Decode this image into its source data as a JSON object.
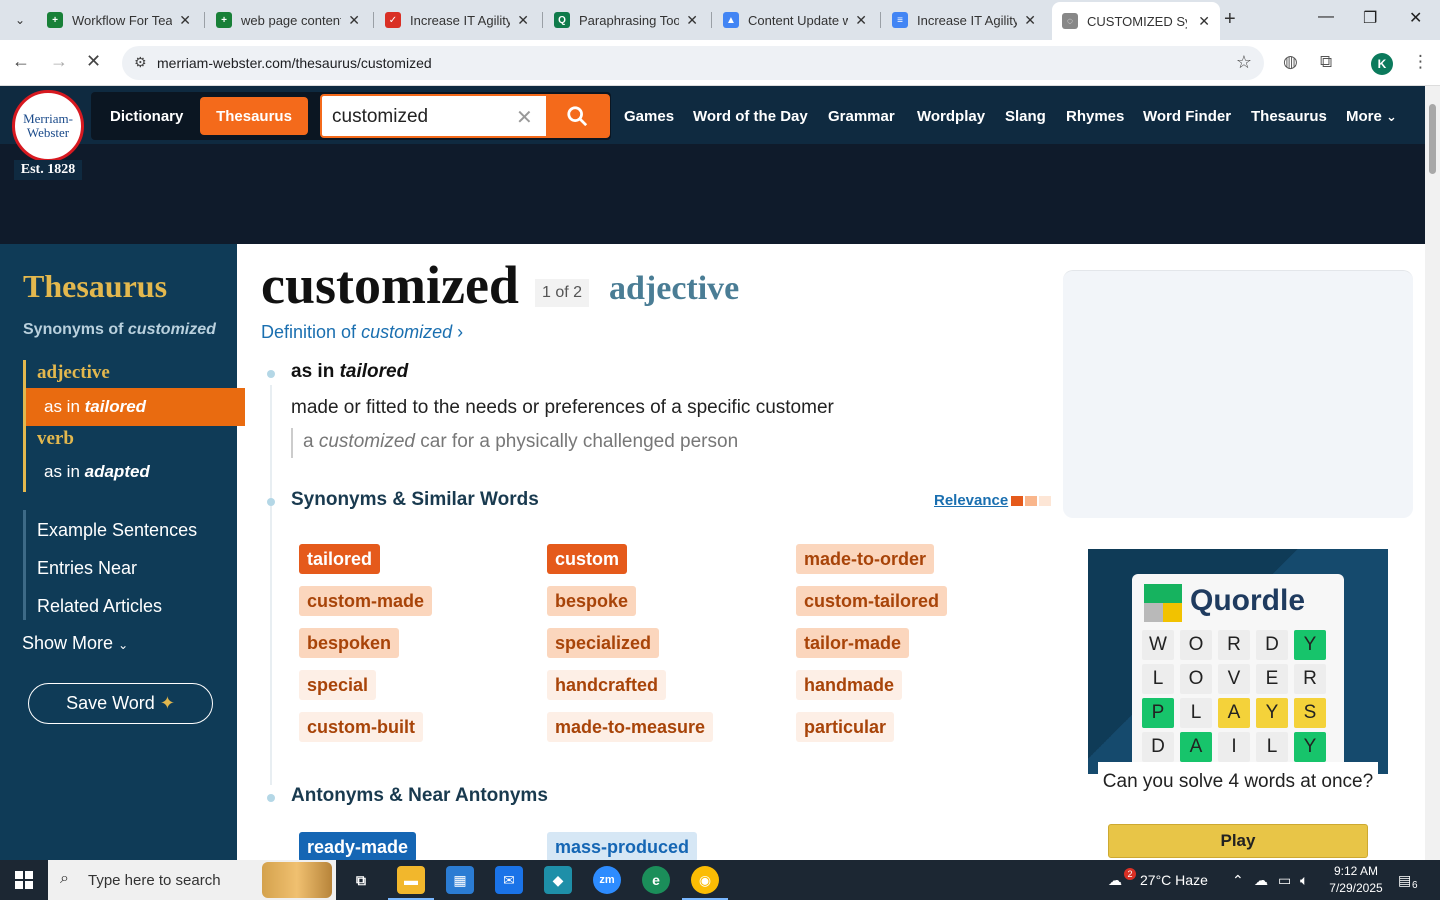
{
  "browser": {
    "tabs": [
      {
        "label": "Workflow For Tear",
        "color": "#188038",
        "glyph": "+"
      },
      {
        "label": "web page content",
        "color": "#188038",
        "glyph": "+"
      },
      {
        "label": "Increase IT Agility",
        "color": "#d93025",
        "glyph": "✓"
      },
      {
        "label": "Paraphrasing Tool",
        "color": "#0f7b4b",
        "glyph": "Q"
      },
      {
        "label": "Content Update w",
        "color": "#4285f4",
        "glyph": "▲"
      },
      {
        "label": "Increase IT Agility",
        "color": "#4285f4",
        "glyph": "≡"
      },
      {
        "label": "CUSTOMIZED Syn",
        "color": "#888888",
        "glyph": "◌"
      }
    ],
    "url": "merriam-webster.com/thesaurus/customized",
    "profile_initial": "K"
  },
  "mw": {
    "logo_line1": "Merriam-",
    "logo_line2": "Webster",
    "est": "Est. 1828",
    "seg_dictionary": "Dictionary",
    "seg_thesaurus": "Thesaurus",
    "search_value": "customized",
    "nav": [
      "Games",
      "Word of the Day",
      "Grammar",
      "Wordplay",
      "Slang",
      "Rhymes",
      "Word Finder",
      "Thesaurus",
      "More"
    ]
  },
  "sidebar": {
    "title": "Thesaurus",
    "subtitle_prefix": "Synonyms of ",
    "subtitle_word": "customized",
    "pos_adj": "adjective",
    "sense_adj_prefix": "as in ",
    "sense_adj_word": "tailored",
    "pos_verb": "verb",
    "sense_verb_prefix": "as in ",
    "sense_verb_word": "adapted",
    "links": [
      "Example Sentences",
      "Entries Near",
      "Related Articles"
    ],
    "show_more": "Show More",
    "save_word": "Save Word"
  },
  "entry": {
    "headword": "customized",
    "count": "1 of 2",
    "pos": "adjective",
    "def_link_prefix": "Definition of ",
    "def_link_word": "customized",
    "sense_prefix": "as in ",
    "sense_word": "tailored",
    "definition": "made or fitted to the needs or preferences of a specific customer",
    "example_prefix": "a ",
    "example_word": "customized",
    "example_suffix": " car for a physically challenged person",
    "synonyms_heading": "Synonyms & Similar Words",
    "relevance": "Relevance",
    "synonyms": [
      {
        "word": "tailored",
        "level": "hi"
      },
      {
        "word": "custom",
        "level": "hi"
      },
      {
        "word": "made-to-order",
        "level": "md"
      },
      {
        "word": "custom-made",
        "level": "md"
      },
      {
        "word": "bespoke",
        "level": "md"
      },
      {
        "word": "custom-tailored",
        "level": "md"
      },
      {
        "word": "bespoken",
        "level": "md"
      },
      {
        "word": "specialized",
        "level": "md"
      },
      {
        "word": "tailor-made",
        "level": "md"
      },
      {
        "word": "special",
        "level": "lo"
      },
      {
        "word": "handcrafted",
        "level": "lo"
      },
      {
        "word": "handmade",
        "level": "lo"
      },
      {
        "word": "custom-built",
        "level": "lo"
      },
      {
        "word": "made-to-measure",
        "level": "lo"
      },
      {
        "word": "particular",
        "level": "lo"
      }
    ],
    "antonyms_heading": "Antonyms & Near Antonyms",
    "antonyms": [
      {
        "word": "ready-made",
        "level": "ant"
      },
      {
        "word": "mass-produced",
        "level": "antlo"
      }
    ]
  },
  "quordle": {
    "title": "Quordle",
    "grid": [
      [
        [
          "W",
          ""
        ],
        [
          "O",
          ""
        ],
        [
          "R",
          ""
        ],
        [
          "D",
          ""
        ],
        [
          "Y",
          "green"
        ]
      ],
      [
        [
          "L",
          ""
        ],
        [
          "O",
          ""
        ],
        [
          "V",
          ""
        ],
        [
          "E",
          ""
        ],
        [
          "R",
          ""
        ]
      ],
      [
        [
          "P",
          "green"
        ],
        [
          "L",
          ""
        ],
        [
          "A",
          "yellow"
        ],
        [
          "Y",
          "yellow"
        ],
        [
          "S",
          "yellow"
        ]
      ],
      [
        [
          "D",
          ""
        ],
        [
          "A",
          "green"
        ],
        [
          "I",
          ""
        ],
        [
          "L",
          ""
        ],
        [
          "Y",
          "green"
        ]
      ]
    ],
    "question": "Can you solve 4 words at once?",
    "play": "Play"
  },
  "taskbar": {
    "search_placeholder": "Type here to search",
    "weather": "27°C  Haze",
    "weather_badge": "2",
    "time": "9:12 AM",
    "date": "7/29/2025",
    "notif_count": "6"
  },
  "colors": {
    "mw_orange": "#f46a1b",
    "mw_navy": "#0f3b57",
    "mw_gold": "#e3b84e"
  }
}
